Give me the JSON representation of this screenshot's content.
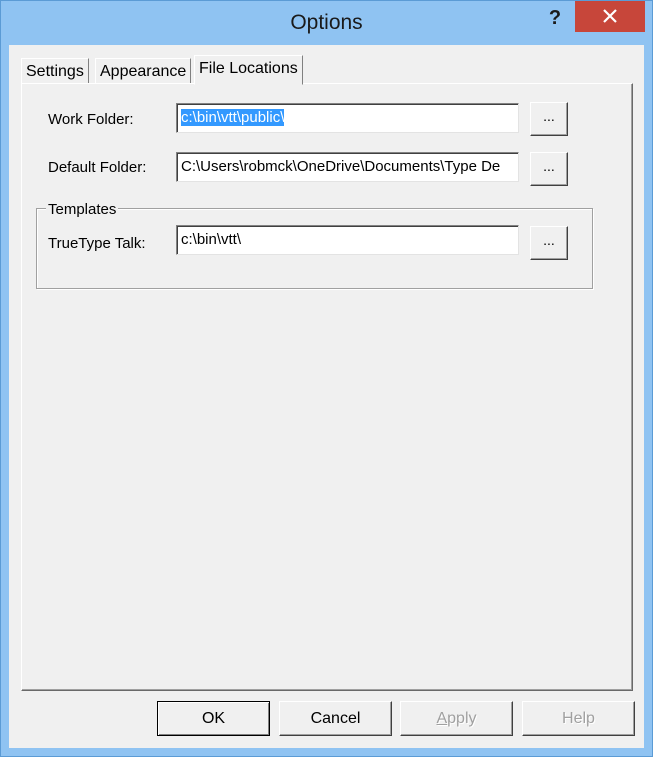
{
  "window": {
    "title": "Options",
    "help_glyph": "?",
    "close_icon": "close-icon"
  },
  "tabs": [
    {
      "label": "Settings",
      "active": false
    },
    {
      "label": "Appearance",
      "active": false
    },
    {
      "label": "File Locations",
      "active": true
    }
  ],
  "file_locations": {
    "work_folder": {
      "label": "Work Folder:",
      "value": "c:\\bin\\vtt\\public\\",
      "selected": true,
      "browse_label": "..."
    },
    "default_folder": {
      "label": "Default Folder:",
      "value": "C:\\Users\\robmck\\OneDrive\\Documents\\Type De",
      "browse_label": "..."
    },
    "templates": {
      "title": "Templates",
      "truetype_talk": {
        "label": "TrueType Talk:",
        "value": "c:\\bin\\vtt\\",
        "browse_label": "..."
      }
    }
  },
  "buttons": {
    "ok": "OK",
    "cancel": "Cancel",
    "apply_first": "A",
    "apply_rest": "pply",
    "help": "Help"
  },
  "colors": {
    "title_bar": "#8fc3f2",
    "close_button": "#c7463a",
    "selection": "#3399ff"
  }
}
